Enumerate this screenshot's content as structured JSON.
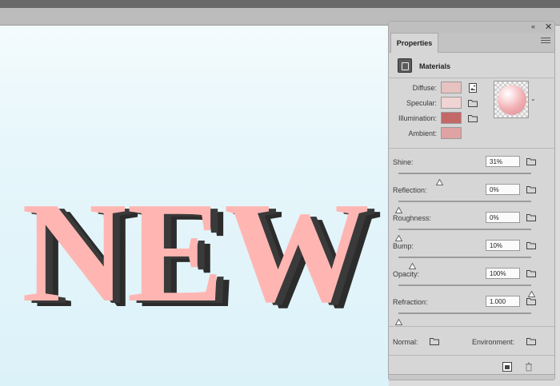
{
  "canvas": {
    "text": "NEW",
    "fill_color": "#ffb6b3",
    "shadow_color": "#2c2c2c"
  },
  "panel": {
    "tab_label": "Properties",
    "section_title": "Materials",
    "controls": {
      "collapse_glyph": "«",
      "close_glyph": "✕"
    },
    "colors": [
      {
        "label": "Diffuse:",
        "swatch": "#e6c2c0",
        "folder_icon": "texture-document-icon"
      },
      {
        "label": "Specular:",
        "swatch": "#f0d3d3",
        "folder_icon": "folder-icon"
      },
      {
        "label": "Illumination:",
        "swatch": "#c46867",
        "folder_icon": "folder-icon"
      },
      {
        "label": "Ambient:",
        "swatch": "#dea3a2",
        "folder_icon": ""
      }
    ],
    "sliders": [
      {
        "label": "Shine:",
        "value": "31%",
        "level": 0.31
      },
      {
        "label": "Reflection:",
        "value": "0%",
        "level": 0
      },
      {
        "label": "Roughness:",
        "value": "0%",
        "level": 0
      },
      {
        "label": "Bump:",
        "value": "10%",
        "level": 0.1
      },
      {
        "label": "Opacity:",
        "value": "100%",
        "level": 1
      },
      {
        "label": "Refraction:",
        "value": "1.000",
        "level": 0
      }
    ],
    "normal_label": "Normal:",
    "environment_label": "Environment:",
    "preview_icon": "material-sphere-preview",
    "footer_icons": [
      "render-icon",
      "trash-icon"
    ]
  }
}
